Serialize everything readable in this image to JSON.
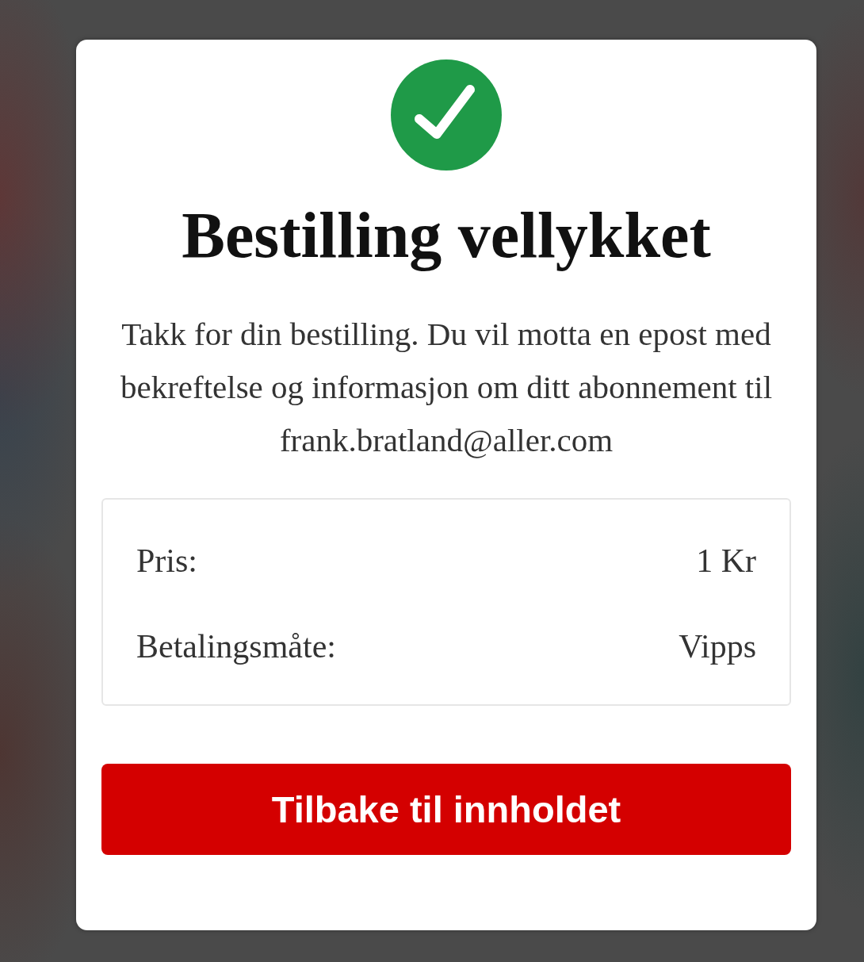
{
  "dialog": {
    "success": true,
    "title": "Bestilling vellykket",
    "message": "Takk for din bestilling. Du vil motta en epost med bekreftelse og informasjon om ditt abonnement til frank.bratland@aller.com",
    "details": [
      {
        "label": "Pris:",
        "value": "1 Kr"
      },
      {
        "label": "Betalingsmåte:",
        "value": "Vipps"
      }
    ],
    "button": "Tilbake til innholdet"
  }
}
